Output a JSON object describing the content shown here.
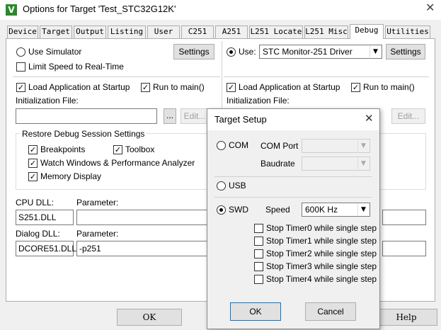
{
  "window": {
    "title": "Options for Target 'Test_STC32G12K'",
    "icon_letter": "V",
    "close": "✕"
  },
  "tabs": [
    "Device",
    "Target",
    "Output",
    "Listing",
    "User",
    "C251",
    "A251",
    "L251 Locate",
    "L251 Misc",
    "Debug",
    "Utilities"
  ],
  "left": {
    "use_simulator": "Use Simulator",
    "settings": "Settings",
    "limit_speed": "Limit Speed to Real-Time",
    "load_app": "Load Application at Startup",
    "run_to_main": "Run to main()",
    "init_file": "Initialization File:",
    "browse": "...",
    "edit": "Edit...",
    "restore_group": "Restore Debug Session Settings",
    "breakpoints": "Breakpoints",
    "toolbox": "Toolbox",
    "watch_windows": "Watch Windows & Performance Analyzer",
    "memory_display": "Memory Display",
    "cpu_dll": "CPU DLL:",
    "parameter1": "Parameter:",
    "cpu_dll_value": "S251.DLL",
    "dialog_dll": "Dialog DLL:",
    "parameter2": "Parameter:",
    "dialog_dll_value": "DCORE51.DLL",
    "dialog_param_value": "-p251"
  },
  "right": {
    "use": "Use:",
    "driver": "STC Monitor-251 Driver",
    "settings": "Settings",
    "load_app": "Load Application at Startup",
    "run_to_main": "Run to main()",
    "init_file": "Initialization File:",
    "edit": "Edit..."
  },
  "bottom": {
    "ok": "OK",
    "help": "Help"
  },
  "dialog": {
    "title": "Target Setup",
    "close": "✕",
    "com": "COM",
    "com_port": "COM Port",
    "baudrate": "Baudrate",
    "usb": "USB",
    "swd": "SWD",
    "speed": "Speed",
    "speed_value": "600K Hz",
    "stop_timers": [
      "Stop Timer0 while single step",
      "Stop Timer1 while single step",
      "Stop Timer2 while single step",
      "Stop Timer3 while single step",
      "Stop Timer4 while single step"
    ],
    "ok": "OK",
    "cancel": "Cancel"
  }
}
